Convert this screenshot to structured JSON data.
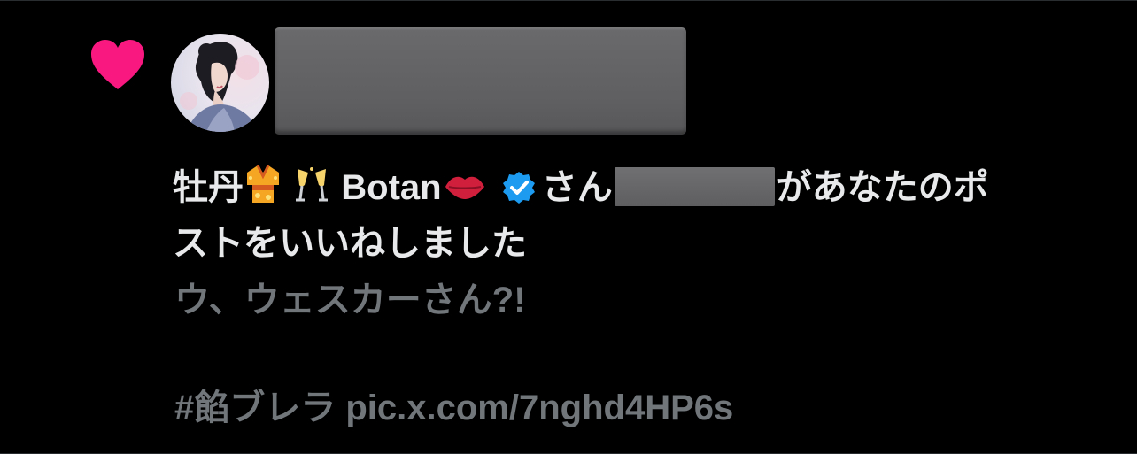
{
  "notification": {
    "user_display_name": "牡丹",
    "user_name_text": "Botan",
    "name_emojis_before": [
      "👘",
      "🥂"
    ],
    "name_emoji_after": "💋",
    "honorific": "さん",
    "action_text_part1": "があなたのポ",
    "action_text_part2": "ストをいいねしました",
    "post_text_line1": "ウ、ウェスカーさん?!",
    "post_text_line2": "#餡ブレラ pic.x.com/7nghd4HP6s",
    "heart_color": "#f91880",
    "verified_color": "#1d9bf0"
  }
}
